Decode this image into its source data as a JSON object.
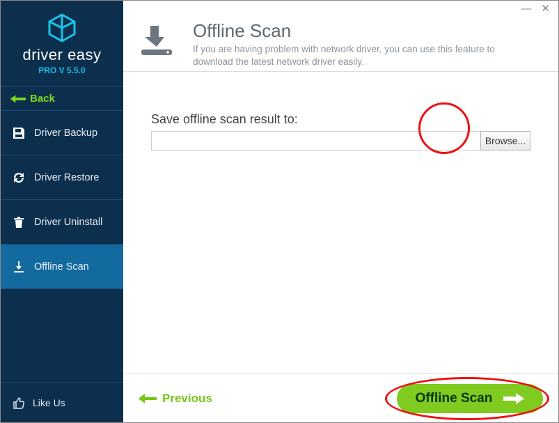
{
  "app": {
    "brand": "driver easy",
    "version": "PRO V 5.5.0"
  },
  "sidebar": {
    "back_label": "Back",
    "items": [
      {
        "label": "Driver Backup"
      },
      {
        "label": "Driver Restore"
      },
      {
        "label": "Driver Uninstall"
      },
      {
        "label": "Offline Scan"
      }
    ],
    "like_label": "Like Us"
  },
  "header": {
    "title": "Offline Scan",
    "description": "If you are having problem with network driver, you can use this feature to download the latest network driver easily."
  },
  "content": {
    "field_label": "Save offline scan result to:",
    "path_value": "",
    "browse_label": "Browse..."
  },
  "footer": {
    "previous_label": "Previous",
    "scan_label": "Offline Scan"
  },
  "window": {
    "minimize": "—",
    "close": "✕"
  }
}
